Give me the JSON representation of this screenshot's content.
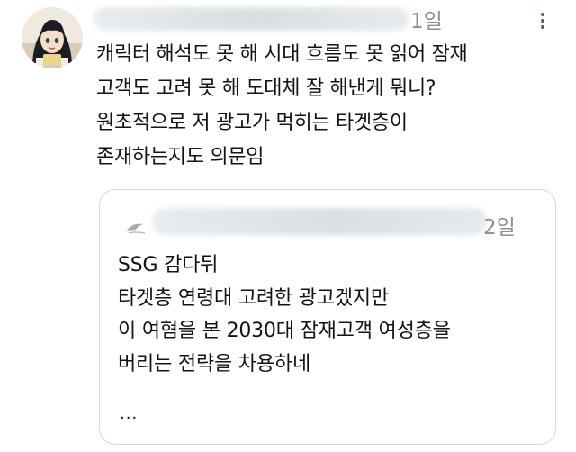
{
  "tweet": {
    "time": "1일",
    "lines": [
      "캐릭터 해석도 못 해 시대 흐름도 못 읽어 잠재",
      "고객도 고려 못 해 도대체 잘 해낸게 뭐니?",
      "원초적으로 저 광고가 먹히는 타겟층이",
      "존재하는지도 의문임"
    ]
  },
  "quote": {
    "time": "2일",
    "lines": [
      "SSG 감다뒤",
      "타겟층 연령대 고려한 광고겠지만",
      "이 여혐을 본 2030대 잠재고객 여성층을",
      "버리는 전략을 차용하네"
    ],
    "ellipsis": "..."
  },
  "icons": {
    "more": "more-horizontal-icon",
    "avatar": "avatar-image",
    "quote_avatar": "quote-avatar-image"
  },
  "colors": {
    "text": "#0f1419",
    "secondary": "#8a8f94",
    "border": "#cfd9de"
  }
}
